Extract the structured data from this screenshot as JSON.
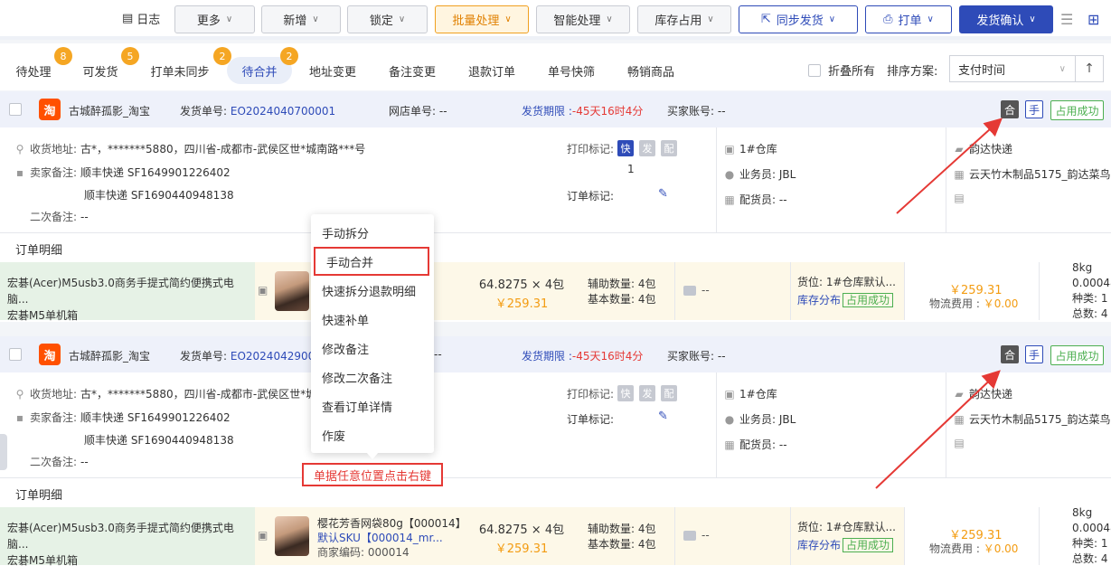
{
  "toolbar": {
    "log_label": "日志",
    "buttons": [
      "更多",
      "新增",
      "锁定",
      "批量处理",
      "智能处理",
      "库存占用",
      "同步发货",
      "打单",
      "发货确认"
    ]
  },
  "tabs": {
    "items": [
      "待处理",
      "可发货",
      "打单未同步",
      "待合并",
      "地址变更",
      "备注变更",
      "退款订单",
      "单号快筛",
      "畅销商品"
    ],
    "badges": [
      "8",
      "5",
      "2",
      "2"
    ],
    "fold_all": "折叠所有",
    "sort_label": "排序方案:",
    "sort_value": "支付时间"
  },
  "orders": [
    {
      "shop": "古城醉孤影_淘宝",
      "shop_icon": "淘",
      "ship_no_label": "发货单号:",
      "ship_no": "EO2024040700001",
      "store_no": "网店单号: --",
      "deadline_label": "发货期限 :",
      "deadline": "-45天16时4分",
      "buyer": "买家账号: --",
      "tag_merge": "合",
      "tag_manual": "手",
      "tag_status": "占用成功",
      "address_label": "收货地址:",
      "address": "古*，*******5880，四川省-成都市-武侯区世*城南路***号",
      "seller_note_label": "卖家备注:",
      "seller_note_1": "顺丰快递 SF1649901226402",
      "seller_note_2": "顺丰快递 SF1690440948138",
      "second_note_label": "二次备注:",
      "second_note": "--",
      "print_mark_label": "打印标记:",
      "print_tags": [
        "快",
        "发",
        "配"
      ],
      "print_count": "1",
      "order_mark_label": "订单标记:",
      "warehouse": "1#仓库",
      "salesman": "业务员: JBL",
      "picker": "配货员: --",
      "express": "韵达快递",
      "express_detail": "云天竹木制品5175_韵达菜鸟",
      "detail_title": "订单明细",
      "item_name_1": "宏碁(Acer)M5usb3.0商务手提式简约便携式电脑...",
      "item_name_2": "宏碁M5单机箱",
      "sku_title": "樱花芳香网袋80g【000014】",
      "sku_sub": "默认SKU【000014_mr...",
      "sku_code": "商家编码: 000014",
      "qty": "64.8275 × 4包",
      "unit_price": "￥259.31",
      "aux_qty": "辅助数量: 4包",
      "base_qty": "基本数量: 4包",
      "msg": "--",
      "loc": "货位: 1#仓库默认...",
      "stock_dist": "库存分布",
      "stock_ok": "占用成功",
      "total": "￥259.31",
      "logistics_label": "物流费用 :",
      "logistics": "￥0.00",
      "weight": "8kg",
      "volume": "0.00048",
      "kind": "种类: 1",
      "count": "总数: 4"
    }
  ],
  "context_menu": {
    "items": [
      "手动拆分",
      "手动合并",
      "快速拆分退款明细",
      "快速补单",
      "修改备注",
      "修改二次备注",
      "查看订单详情",
      "作废"
    ],
    "hint": "单据任意位置点击右键"
  },
  "colors": {
    "brand": "#2e4bb8",
    "warn": "#f5a623",
    "danger": "#e53935",
    "success": "#4caf50"
  }
}
